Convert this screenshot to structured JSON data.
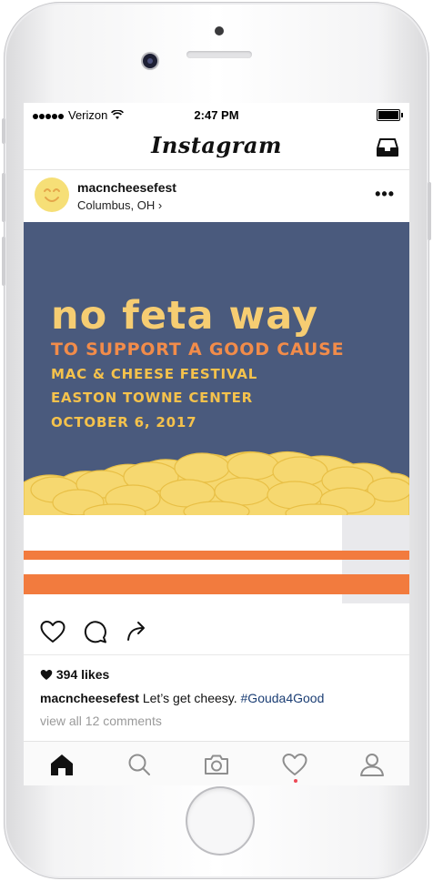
{
  "status_bar": {
    "carrier": "Verizon",
    "time": "2:47 PM"
  },
  "nav": {
    "app_title": "Instagram",
    "inbox_icon": "inbox-tray-icon"
  },
  "post": {
    "username": "macncheesefest",
    "location": "Columbus, OH",
    "location_chevron": "›",
    "more_label": "•••",
    "image": {
      "headline": "no feta way",
      "subline": "TO SUPPORT A GOOD CAUSE",
      "detail_1": "MAC & CHEESE FESTIVAL",
      "detail_2": "EASTON TOWNE CENTER",
      "detail_3": "OCTOBER 6, 2017",
      "colors": {
        "background": "#4a5a7d",
        "headline": "#f6cd72",
        "subline": "#f28c4a",
        "detail": "#f5c24c",
        "macaroni": "#f6d870",
        "bowl_stripe": "#f27b3e"
      }
    },
    "likes": "394 likes",
    "caption_user": "macncheesefest",
    "caption_text": "Let’s get cheesy.",
    "caption_hashtag": "#Gouda4Good",
    "view_comments": "view all 12 comments"
  },
  "tab_bar": {
    "items": [
      "home-icon",
      "search-icon",
      "camera-icon",
      "heart-icon",
      "profile-icon"
    ],
    "active": "home-icon",
    "notification_color": "#ed4956"
  }
}
